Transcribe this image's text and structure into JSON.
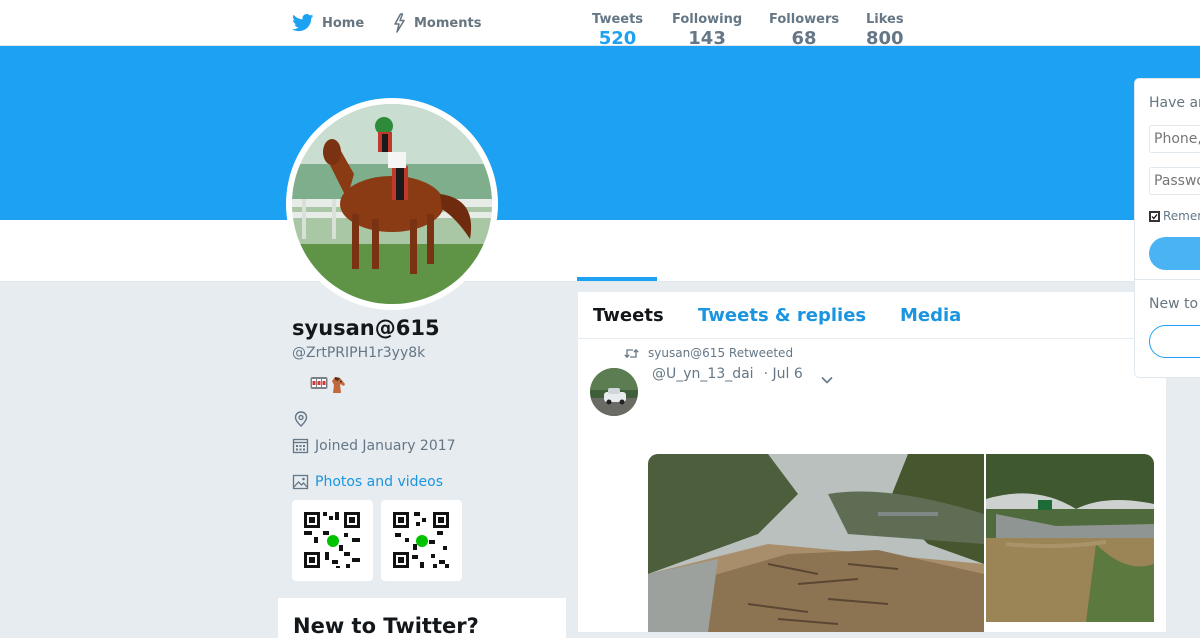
{
  "nav": {
    "home_label": "Home",
    "moments_label": "Moments"
  },
  "colors": {
    "brand": "#1da1f2",
    "link": "#1b95e0",
    "page_bg": "#e6ecf0"
  },
  "stats": [
    {
      "label": "Tweets",
      "value": "520",
      "active": true
    },
    {
      "label": "Following",
      "value": "143"
    },
    {
      "label": "Followers",
      "value": "68"
    },
    {
      "label": "Likes",
      "value": "800"
    }
  ],
  "profile": {
    "name": "syusan@615",
    "handle": "@ZrtPRIPH1r3yy8k",
    "bio_emoji": [
      "slot-machine-emoji",
      "horse-emoji"
    ],
    "joined": "Joined January 2017",
    "photos_link": "Photos and videos"
  },
  "sidebar_card": {
    "title": "New to Twitter?"
  },
  "timeline": {
    "tabs": [
      "Tweets",
      "Tweets & replies",
      "Media"
    ],
    "tweet": {
      "retweet_label": "syusan@615 Retweeted",
      "author": "@U_yn_13_dai",
      "date": "· Jul 6"
    }
  },
  "login": {
    "title": "Have an account?",
    "phone_placeholder": "Phone, email or username",
    "password_placeholder": "Password",
    "remember_label": "Remember me",
    "new_label": "New to Twitter?"
  },
  "icons": {
    "home": "twitter-bird-icon",
    "moments": "lightning-icon",
    "location": "location-pin-icon",
    "calendar": "calendar-icon",
    "photos": "image-icon",
    "retweet": "retweet-icon",
    "caret": "chevron-down-icon"
  }
}
